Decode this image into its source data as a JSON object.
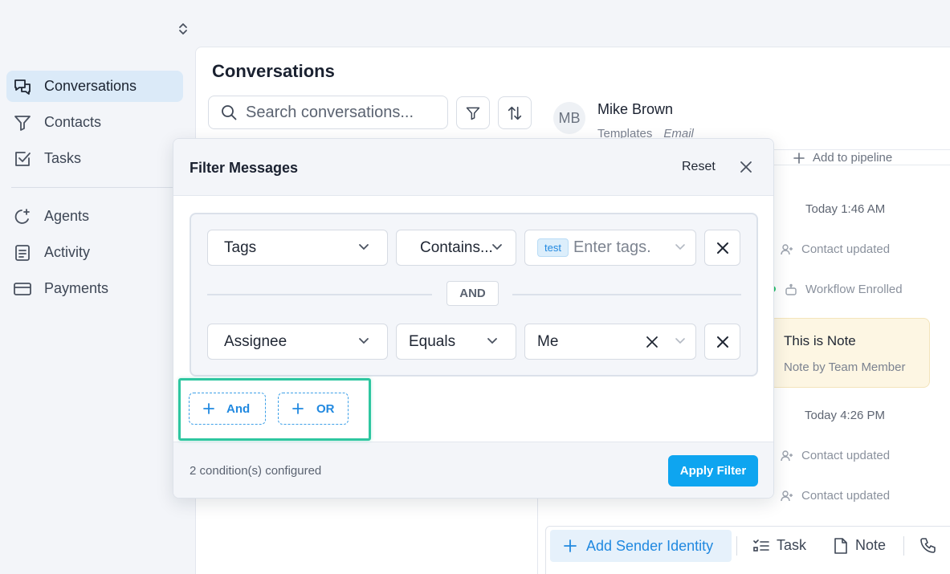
{
  "sidebar": {
    "items": [
      {
        "label": "Conversations",
        "icon": "chat-bubbles-icon",
        "active": true
      },
      {
        "label": "Contacts",
        "icon": "funnel-icon"
      },
      {
        "label": "Tasks",
        "icon": "checkbox-icon"
      },
      {
        "label": "Agents",
        "icon": "agents-sparkle-icon"
      },
      {
        "label": "Activity",
        "icon": "document-list-icon"
      },
      {
        "label": "Payments",
        "icon": "credit-card-icon"
      }
    ]
  },
  "main": {
    "title": "Conversations",
    "search_placeholder": "Search conversations..."
  },
  "contact": {
    "initials": "MB",
    "name": "Mike Brown",
    "channel_label": "Templates",
    "channel_type": "Email",
    "add_pipeline": "Add to pipeline"
  },
  "timeline": {
    "time1": "Today 1:46 AM",
    "event1": "Contact updated",
    "event2": "Workflow Enrolled",
    "note_title": "This is Note",
    "note_sub": "Note by Team Member",
    "time2": "Today 4:26 PM",
    "event3": "Contact updated",
    "event4": "Contact updated"
  },
  "compose": {
    "sender": "Add Sender Identity",
    "task": "Task",
    "note": "Note"
  },
  "filter": {
    "title": "Filter Messages",
    "reset": "Reset",
    "conditions": [
      {
        "field": "Tags",
        "operator": "Contains...",
        "tag": "test",
        "value_placeholder": "Enter tags."
      },
      {
        "field": "Assignee",
        "operator": "Equals",
        "value": "Me"
      }
    ],
    "joiner": "AND",
    "add_and": "And",
    "add_or": "OR",
    "count_text": "2 condition(s) configured",
    "apply": "Apply Filter"
  },
  "colors": {
    "accent": "#0ea5f0",
    "highlight": "#2ec6a0",
    "active_nav": "#dbeaf8"
  }
}
